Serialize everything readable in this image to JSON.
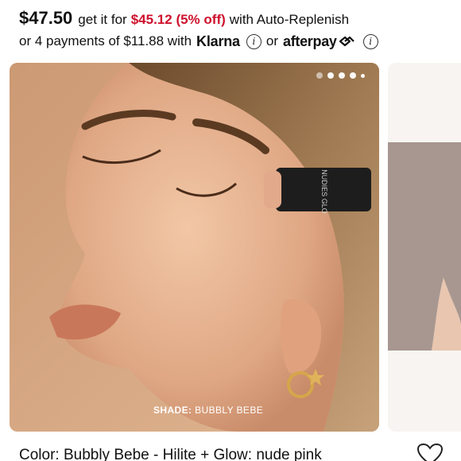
{
  "price": {
    "main": "$47.50",
    "get_it_for": "get it for",
    "discount": "$45.12 (5% off)",
    "auto_replenish": "with Auto-Replenish",
    "installments": "or 4 payments of $11.88 with",
    "klarna": "Klarna",
    "or": "or",
    "afterpay": "afterpay"
  },
  "carousel": {
    "dots_count": 5,
    "active_index": 0,
    "shade_label": "SHADE:",
    "shade_name": "BUBBLY BEBE",
    "stick_brand": "NUDIES GLO"
  },
  "product": {
    "color_line": "Color: Bubbly Bebe - Hilite + Glow: nude pink"
  },
  "colors": {
    "discount": "#cf112c",
    "skin": "#d4a684",
    "text": "#111111"
  }
}
